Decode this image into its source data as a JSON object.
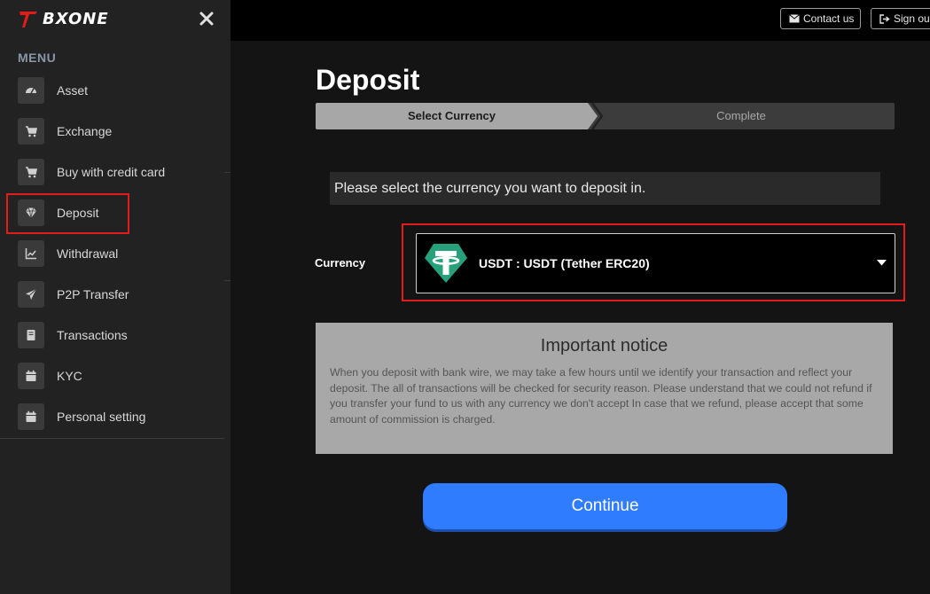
{
  "app": {
    "logo_text": "BXONE",
    "accent_color": "#e21b1b"
  },
  "sidebar": {
    "menu_title": "MENU",
    "close_icon": "close-icon",
    "items": [
      {
        "label": "Asset",
        "icon": "dashboard-icon"
      },
      {
        "label": "Exchange",
        "icon": "cart-icon"
      },
      {
        "label": "Buy with credit card",
        "icon": "cart-icon"
      },
      {
        "label": "Deposit",
        "icon": "diamond-icon",
        "selected": true
      },
      {
        "label": "Withdrawal",
        "icon": "chart-icon"
      },
      {
        "label": "P2P Transfer",
        "icon": "paper-plane-icon"
      },
      {
        "label": "Transactions",
        "icon": "book-icon"
      },
      {
        "label": "KYC",
        "icon": "calendar-icon"
      },
      {
        "label": "Personal setting",
        "icon": "calendar-icon"
      }
    ]
  },
  "topbar": {
    "contact_label": "Contact us",
    "signout_label": "Sign out"
  },
  "main": {
    "title": "Deposit",
    "steps": [
      {
        "label": "Select Currency",
        "active": true
      },
      {
        "label": "Complete",
        "active": false
      }
    ],
    "instruction": "Please select the currency you want to deposit in.",
    "currency_label": "Currency",
    "currency_value": "USDT : USDT (Tether ERC20)",
    "currency_icon": "tether-icon",
    "notice_title": "Important notice",
    "notice_body": "When you deposit with bank wire, we may take a few hours until we identify your transaction and reflect your deposit. The all of transactions will be checked for security reason. Please understand that we could not refund if you transfer your fund to us with any currency we don't accept In case that we refund, please accept that some amount of commission is charged.",
    "continue_label": "Continue"
  },
  "colors": {
    "sidebar_bg": "#222222",
    "main_bg": "#141414",
    "primary_button": "#2f7cff",
    "tether_green": "#26a17b",
    "notice_bg": "#a8a8a8"
  }
}
